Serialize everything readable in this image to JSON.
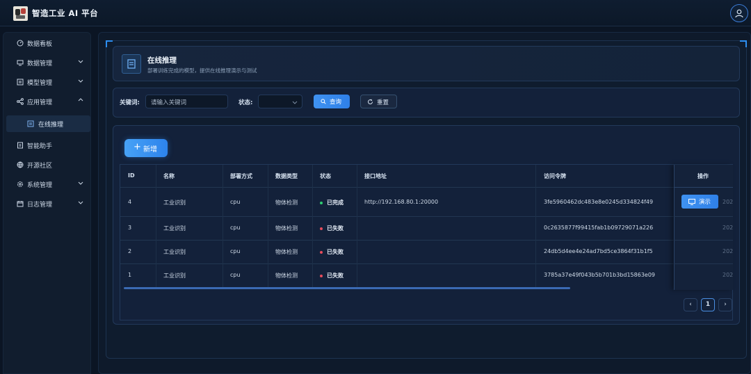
{
  "app": {
    "title": "智造工业 AI 平台"
  },
  "sidebar": {
    "items": [
      {
        "label": "数据看板",
        "icon": "dashboard-icon"
      },
      {
        "label": "数据管理",
        "icon": "monitor-icon",
        "expandable": true
      },
      {
        "label": "模型管理",
        "icon": "model-icon",
        "expandable": true
      },
      {
        "label": "应用管理",
        "icon": "share-icon",
        "expandable": true,
        "expanded": true
      },
      {
        "label": "在线推理",
        "icon": "doc-icon",
        "sub": true,
        "active": true
      },
      {
        "label": "智能助手",
        "icon": "assistant-icon"
      },
      {
        "label": "开源社区",
        "icon": "globe-icon"
      },
      {
        "label": "系统管理",
        "icon": "gear-icon",
        "expandable": true
      },
      {
        "label": "日志管理",
        "icon": "calendar-icon",
        "expandable": true
      }
    ]
  },
  "header": {
    "title": "在线推理",
    "subtitle": "部署训练完成的模型，提供在线推理演示与测试"
  },
  "filters": {
    "keyword_label": "关键词:",
    "keyword_placeholder": "请输入关键词",
    "status_label": "状态:",
    "status_value": "",
    "query_label": "查询",
    "reset_label": "重置"
  },
  "toolbar": {
    "add_label": "新增"
  },
  "table": {
    "columns": [
      "ID",
      "名称",
      "部署方式",
      "数据类型",
      "状态",
      "接口地址",
      "访问令牌",
      "操作"
    ],
    "rows": [
      {
        "id": "4",
        "name": "工业识别",
        "deploy": "cpu",
        "dtype": "物体检测",
        "status": "已完成",
        "status_color": "#2ecc71",
        "endpoint": "http://192.168.80.1:20000",
        "token": "3fe5960462dc483e8e0245d334824f49",
        "action": "演示",
        "extra": "202"
      },
      {
        "id": "3",
        "name": "工业识别",
        "deploy": "cpu",
        "dtype": "物体检测",
        "status": "已失败",
        "status_color": "#e74c5c",
        "endpoint": "",
        "token": "0c2635877f99415fab1b09729071a226",
        "action": "",
        "extra": "202"
      },
      {
        "id": "2",
        "name": "工业识别",
        "deploy": "cpu",
        "dtype": "物体检测",
        "status": "已失败",
        "status_color": "#e74c5c",
        "endpoint": "",
        "token": "24db5d4ee4e24ad7bd5ce3864f31b1f5",
        "action": "",
        "extra": "202"
      },
      {
        "id": "1",
        "name": "工业识别",
        "deploy": "cpu",
        "dtype": "物体检测",
        "status": "已失败",
        "status_color": "#e74c5c",
        "endpoint": "",
        "token": "3785a37e49f043b5b701b3bd15863e09",
        "action": "",
        "extra": "202"
      }
    ]
  },
  "pagination": {
    "prev": "‹",
    "current": "1",
    "next": "›"
  },
  "colors": {
    "accent": "#3a8ef0",
    "success": "#2ecc71",
    "danger": "#e74c5c",
    "background": "#0b1524"
  }
}
